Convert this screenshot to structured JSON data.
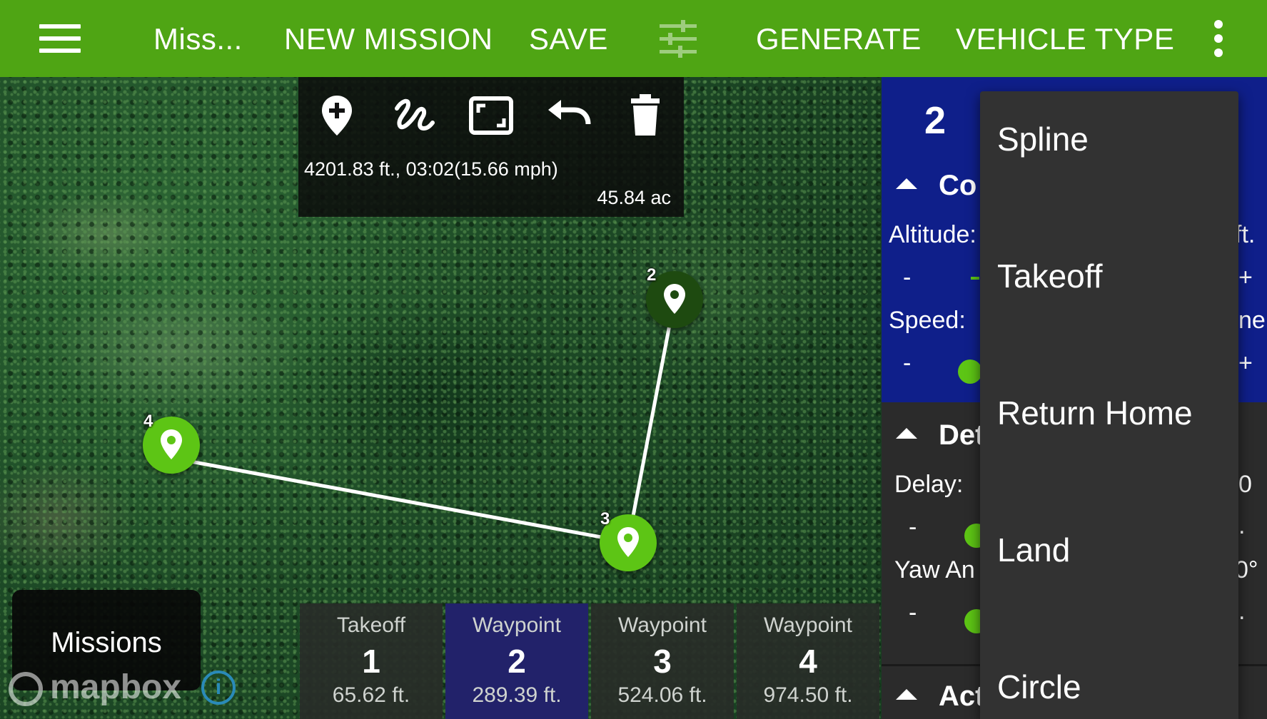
{
  "appbar": {
    "menu_icon": "hamburger-menu-icon",
    "title": "Miss...",
    "new_mission": "NEW MISSION",
    "save": "SAVE",
    "filter_icon": "tune-sliders-icon",
    "generate": "GENERATE",
    "vehicle_type": "VEHICLE TYPE",
    "overflow_icon": "more-vert-icon",
    "color": "#4fa514"
  },
  "toolbar": {
    "tools": [
      "add-waypoint-icon",
      "freehand-draw-icon",
      "fit-to-screen-icon",
      "undo-icon",
      "delete-icon"
    ],
    "distance_time": "4201.83 ft., 03:02(15.66 mph)",
    "area": "45.84 ac"
  },
  "map": {
    "pins": [
      {
        "number": "2",
        "selected": true
      },
      {
        "number": "3",
        "selected": false
      },
      {
        "number": "4",
        "selected": false
      }
    ],
    "missions_button": "Missions",
    "attribution": "mapbox",
    "info_icon": "i"
  },
  "waypoints": [
    {
      "type": "Takeoff",
      "number": "1",
      "distance": "65.62 ft.",
      "selected": false
    },
    {
      "type": "Waypoint",
      "number": "2",
      "distance": "289.39 ft.",
      "selected": true
    },
    {
      "type": "Waypoint",
      "number": "3",
      "distance": "524.06 ft.",
      "selected": false
    },
    {
      "type": "Waypoint",
      "number": "4",
      "distance": "974.50 ft.",
      "selected": false
    }
  ],
  "panel": {
    "waypoint_number": "2",
    "section1": "Co",
    "altitude_label": "Altitude:",
    "altitude_unit": "ft.",
    "minus": "-",
    "plus": "+",
    "speed_label": "Speed:",
    "speed_tail": "ne",
    "section2": "Det",
    "delay_label": "Delay:",
    "delay_tail": "0",
    "yaw_label": "Yaw An",
    "yaw_tail": "0°",
    "dot": ".",
    "section3": "Act"
  },
  "menu": {
    "options": [
      "Spline",
      "Takeoff",
      "Return Home",
      "Land",
      "Circle"
    ]
  }
}
